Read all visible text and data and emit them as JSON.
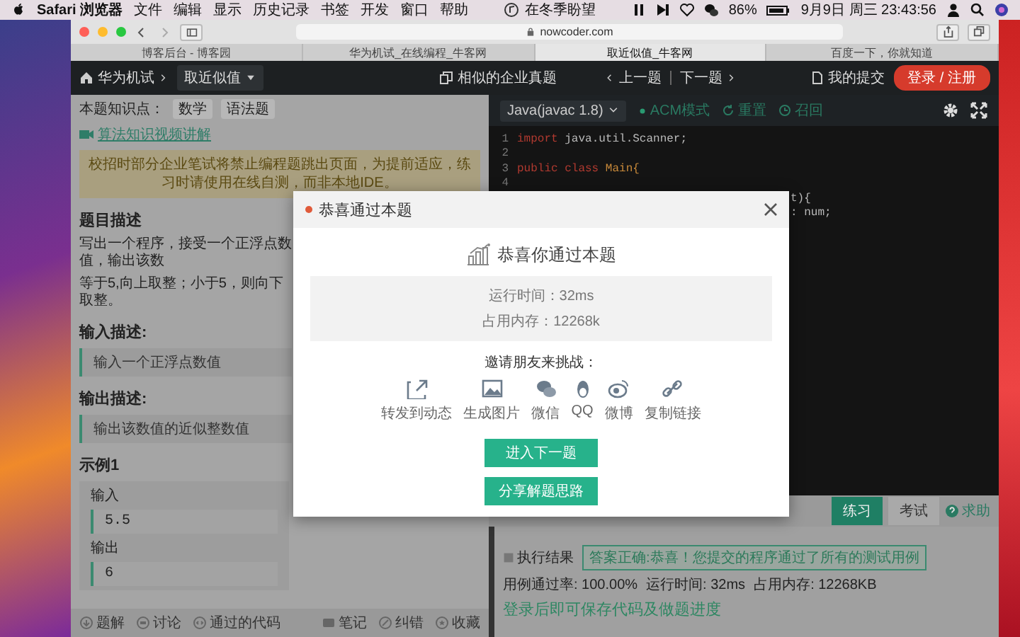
{
  "menu_bar": {
    "app": "Safari 浏览器",
    "menus": [
      "文件",
      "编辑",
      "显示",
      "历史记录",
      "书签",
      "开发",
      "窗口",
      "帮助"
    ],
    "now_playing": "在冬季盼望",
    "battery": "86%",
    "clock": "9月9日 周三 23:43:56"
  },
  "browser": {
    "address": "nowcoder.com",
    "tabs": [
      {
        "label": "博客后台 - 博客园",
        "selected": false
      },
      {
        "label": "华为机试_在线编程_牛客网",
        "selected": false
      },
      {
        "label": "取近似值_牛客网",
        "selected": true
      },
      {
        "label": "百度一下，你就知道",
        "selected": false
      }
    ]
  },
  "site_header": {
    "breadcrumb": "华为机试",
    "problem_select": "取近似值",
    "similar": "相似的企业真题",
    "prev": "上一题",
    "next": "下一题",
    "submissions": "我的提交",
    "login": "登录 / 注册"
  },
  "problem": {
    "knowledge_label": "本题知识点：",
    "tags": [
      "数学",
      "语法题"
    ],
    "video_link": "算法知识视频讲解",
    "notice": "校招时部分企业笔试将禁止编程题跳出页面，为提前适应，练习时请使用在线自测，而非本地IDE。",
    "description_title": "题目描述",
    "description": [
      "写出一个程序，接受一个正浮点数值，输出该数",
      "等于5,向上取整；小于5，则向下取整。"
    ],
    "input_title": "输入描述:",
    "input_desc": "输入一个正浮点数值",
    "output_title": "输出描述:",
    "output_desc": "输出该数值的近似整数值",
    "example_title": "示例1",
    "example_input_label": "输入",
    "example_input": "5.5",
    "example_output_label": "输出",
    "example_output": "6"
  },
  "problem_footer": {
    "left": [
      "题解",
      "讨论",
      "通过的代码"
    ],
    "right": [
      "笔记",
      "纠错",
      "收藏"
    ]
  },
  "editor": {
    "language": "Java(javac 1.8)",
    "mode": "ACM模式",
    "reset": "重置",
    "recall": "召回",
    "lines": [
      {
        "kind": "full",
        "number": "1",
        "tokens": [
          {
            "kind": "keyword",
            "text": "import"
          },
          {
            "kind": "plain",
            "text": " java.util.Scanner;"
          }
        ]
      },
      {
        "kind": "full",
        "number": "2"
      },
      {
        "kind": "full",
        "number": "3",
        "tokens": [
          {
            "kind": "keyword",
            "text": "public class"
          },
          {
            "kind": "name",
            "text": " Main{"
          }
        ]
      },
      {
        "kind": "full",
        "number": "4"
      },
      {
        "kind": "partial",
        "tokens": [
          {
            "kind": "plain",
            "text": "t){"
          }
        ]
      },
      {
        "kind": "partial",
        "tokens": [
          {
            "kind": "plain",
            "text": ": num;"
          }
        ]
      }
    ]
  },
  "run_panel": {
    "tabs": [
      {
        "label": "练习",
        "selected": true
      },
      {
        "label": "考试",
        "selected": false
      }
    ],
    "help": "求助",
    "result_label": "执行结果",
    "result_message": "答案正确:恭喜！您提交的程序通过了所有的测试用例",
    "pass_rate": "用例通过率: 100.00%",
    "run_time": "运行时间: 32ms",
    "memory": "占用内存: 12268KB",
    "login_hint": "登录后即可保存代码及做题进度"
  },
  "dialog": {
    "title": "恭喜通过本题",
    "headline": "恭喜你通过本题",
    "stats": [
      "运行时间：32ms",
      "占用内存：12268k"
    ],
    "invite": "邀请朋友来挑战：",
    "share": [
      "转发到动态",
      "生成图片",
      "微信",
      "QQ",
      "微博",
      "复制链接"
    ],
    "buttons": [
      "进入下一题",
      "分享解题思路"
    ]
  }
}
